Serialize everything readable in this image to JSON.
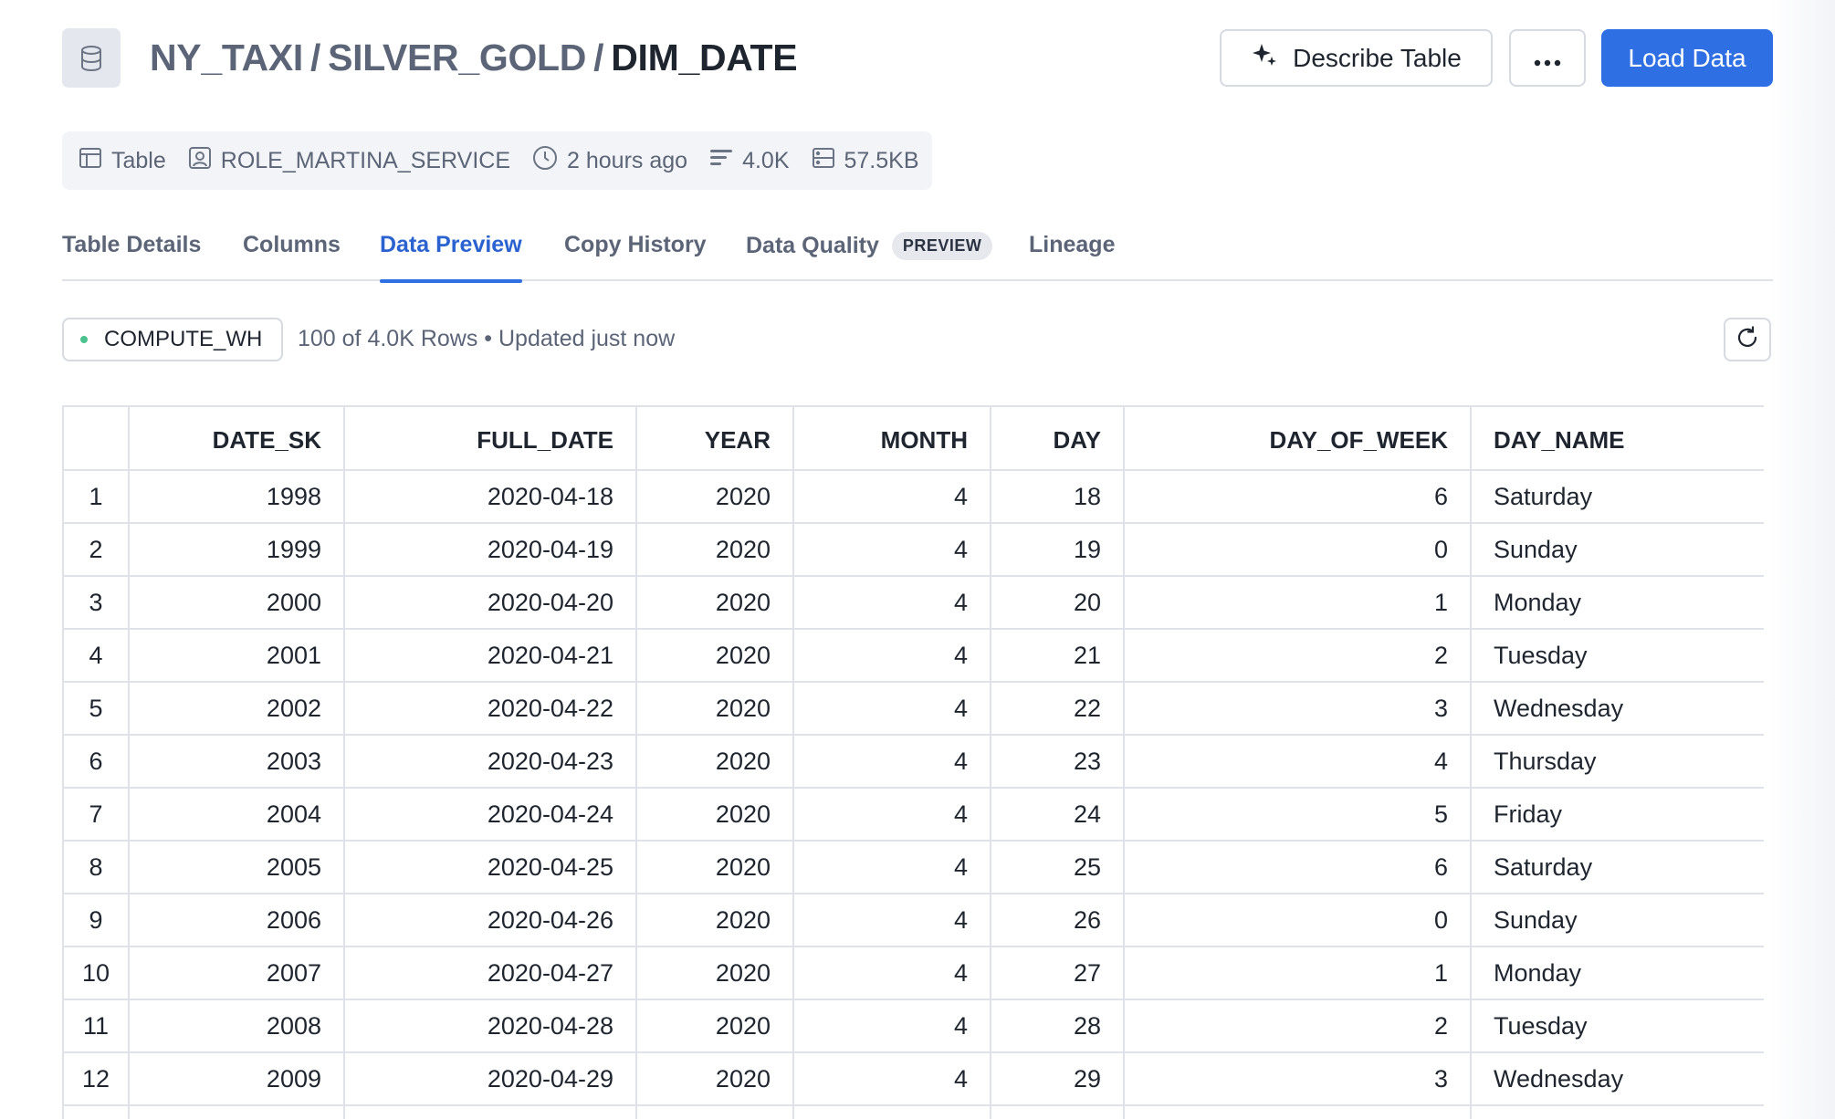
{
  "header": {
    "breadcrumb": [
      "NY_TAXI",
      "SILVER_GOLD"
    ],
    "separator": "/",
    "current": "DIM_DATE",
    "describe_label": "Describe Table",
    "more_label": "...",
    "load_label": "Load Data"
  },
  "meta": {
    "type": "Table",
    "owner": "ROLE_MARTINA_SERVICE",
    "updated": "2 hours ago",
    "rows": "4.0K",
    "size": "57.5KB"
  },
  "tabs": [
    {
      "label": "Table Details",
      "active": false
    },
    {
      "label": "Columns",
      "active": false
    },
    {
      "label": "Data Preview",
      "active": true
    },
    {
      "label": "Copy History",
      "active": false
    },
    {
      "label": "Data Quality",
      "active": false,
      "badge": "PREVIEW"
    },
    {
      "label": "Lineage",
      "active": false
    }
  ],
  "toolbar": {
    "warehouse": "COMPUTE_WH",
    "rows_info": "100 of 4.0K Rows • Updated just now"
  },
  "table": {
    "columns": [
      "",
      "DATE_SK",
      "FULL_DATE",
      "YEAR",
      "MONTH",
      "DAY",
      "DAY_OF_WEEK",
      "DAY_NAME"
    ],
    "rows": [
      [
        "1",
        "1998",
        "2020-04-18",
        "2020",
        "4",
        "18",
        "6",
        "Saturday"
      ],
      [
        "2",
        "1999",
        "2020-04-19",
        "2020",
        "4",
        "19",
        "0",
        "Sunday"
      ],
      [
        "3",
        "2000",
        "2020-04-20",
        "2020",
        "4",
        "20",
        "1",
        "Monday"
      ],
      [
        "4",
        "2001",
        "2020-04-21",
        "2020",
        "4",
        "21",
        "2",
        "Tuesday"
      ],
      [
        "5",
        "2002",
        "2020-04-22",
        "2020",
        "4",
        "22",
        "3",
        "Wednesday"
      ],
      [
        "6",
        "2003",
        "2020-04-23",
        "2020",
        "4",
        "23",
        "4",
        "Thursday"
      ],
      [
        "7",
        "2004",
        "2020-04-24",
        "2020",
        "4",
        "24",
        "5",
        "Friday"
      ],
      [
        "8",
        "2005",
        "2020-04-25",
        "2020",
        "4",
        "25",
        "6",
        "Saturday"
      ],
      [
        "9",
        "2006",
        "2020-04-26",
        "2020",
        "4",
        "26",
        "0",
        "Sunday"
      ],
      [
        "10",
        "2007",
        "2020-04-27",
        "2020",
        "4",
        "27",
        "1",
        "Monday"
      ],
      [
        "11",
        "2008",
        "2020-04-28",
        "2020",
        "4",
        "28",
        "2",
        "Tuesday"
      ],
      [
        "12",
        "2009",
        "2020-04-29",
        "2020",
        "4",
        "29",
        "3",
        "Wednesday"
      ],
      [
        "",
        "",
        "",
        "",
        "",
        "",
        "",
        ""
      ]
    ]
  },
  "colors": {
    "primary": "#2f6fe4",
    "active_tab": "#2a62d0",
    "muted_text": "#5b6577",
    "status_dot": "#4cc28f"
  }
}
